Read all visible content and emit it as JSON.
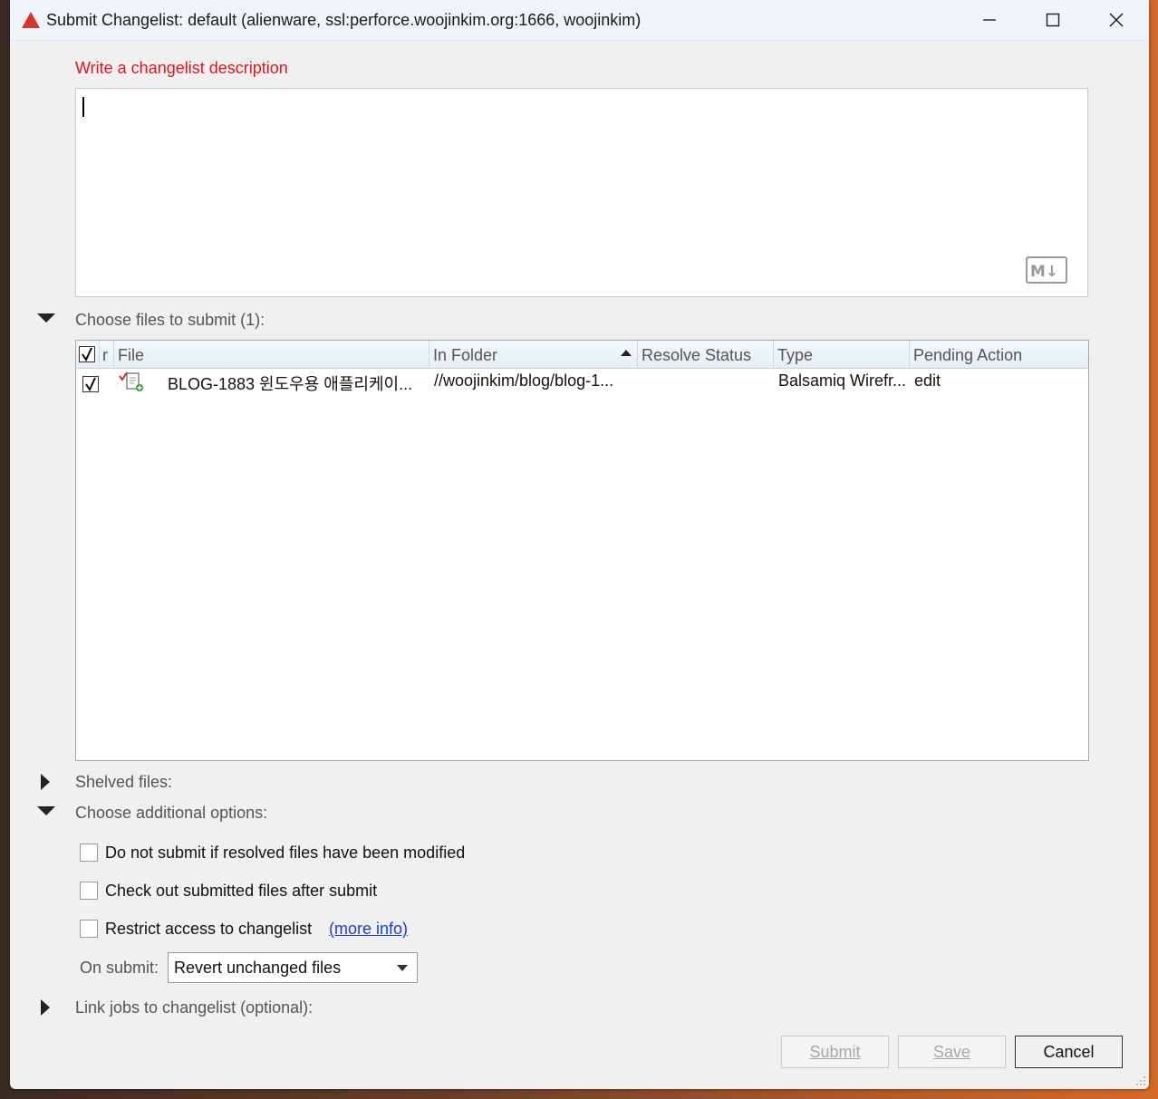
{
  "window": {
    "title": "Submit Changelist: default (alienware,  ssl:perforce.woojinkim.org:1666,  woojinkim)"
  },
  "description": {
    "hint": "Write a changelist description",
    "value": "",
    "md_badge": "M↓"
  },
  "files_section": {
    "label": "Choose files to submit (1):",
    "columns": {
      "check": "",
      "r": "r",
      "file": "File",
      "in_folder": "In Folder",
      "resolve_status": "Resolve Status",
      "type": "Type",
      "pending_action": "Pending Action"
    },
    "rows": [
      {
        "checked": true,
        "file": "BLOG-1883 윈도우용 애플리케이...",
        "in_folder": "//woojinkim/blog/blog-1...",
        "resolve_status": "",
        "type": "Balsamiq Wirefr...",
        "pending_action": "edit"
      }
    ]
  },
  "shelved_section": {
    "label": "Shelved files:"
  },
  "options_section": {
    "label": "Choose additional options:",
    "opt1": "Do not submit if resolved files have been modified",
    "opt2": "Check out submitted files after submit",
    "opt3": "Restrict access to changelist",
    "more_info": "(more info)",
    "on_submit_label": "On submit:",
    "on_submit_value": "Revert unchanged files"
  },
  "jobs_section": {
    "label": "Link jobs to changelist (optional):"
  },
  "buttons": {
    "submit": "Submit",
    "save": "Save",
    "cancel": "Cancel"
  },
  "colors": {
    "hint": "#e0141a",
    "link": "#1a3dcc",
    "window_bg": "#f0f0f0"
  }
}
